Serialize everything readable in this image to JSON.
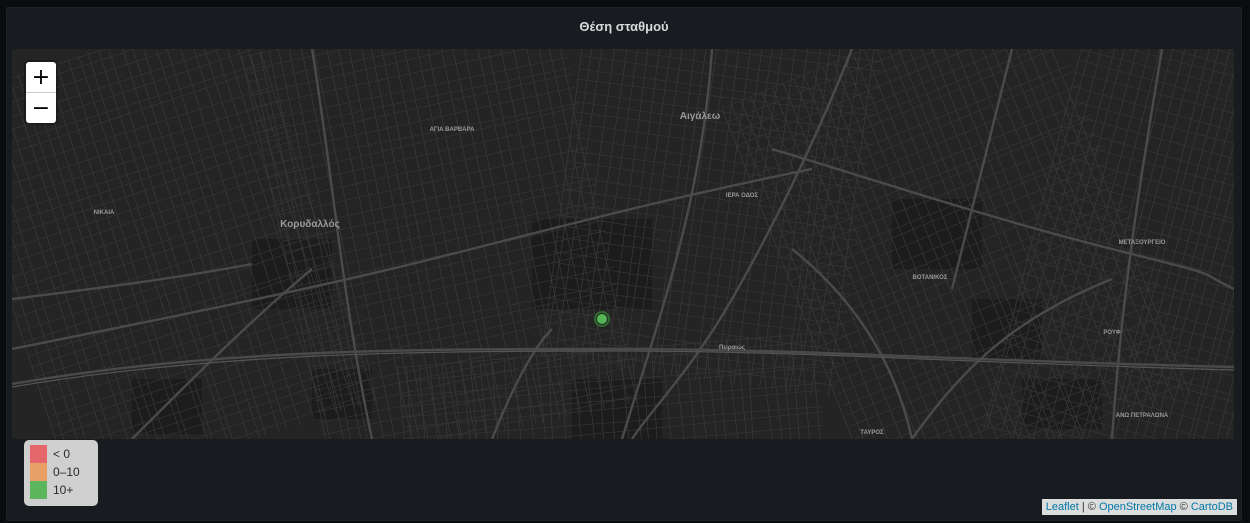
{
  "panel": {
    "title": "Θέση σταθμού"
  },
  "zoom": {
    "in_label": "+",
    "out_label": "−"
  },
  "map": {
    "labels": [
      {
        "text": "Αιγάλεω",
        "size": "big"
      },
      {
        "text": "Κορυδαλλός",
        "size": "big"
      },
      {
        "text": "ΑΓΙΑ ΒΑΡΒΑΡΑ",
        "size": "small"
      },
      {
        "text": "ΝΙΚΑΙΑ",
        "size": "small"
      },
      {
        "text": "ΙΕΡΑ ΟΔΟΣ",
        "size": "small"
      },
      {
        "text": "ΒΟΤΑΝΙΚΟΣ",
        "size": "small"
      },
      {
        "text": "ΜΕΤΑΞΟΥΡΓΕΙΟ",
        "size": "small"
      },
      {
        "text": "ΡΟΥΦ",
        "size": "small"
      },
      {
        "text": "ΤΑΥΡΟΣ",
        "size": "small"
      },
      {
        "text": "ΑΝΩ ΠΕΤΡΑΛΩΝΑ",
        "size": "small"
      },
      {
        "text": "Πειραιώς",
        "size": "small"
      }
    ],
    "marker_color": "#56b356"
  },
  "legend": {
    "items": [
      {
        "label": "< 0",
        "color": "#e5676c"
      },
      {
        "label": "0–10",
        "color": "#e8a066"
      },
      {
        "label": "10+",
        "color": "#5db65d"
      }
    ]
  },
  "attribution": {
    "leaflet": "Leaflet",
    "sep": " | © ",
    "osm": "OpenStreetMap",
    "sep2": " © ",
    "carto": "CartoDB"
  }
}
